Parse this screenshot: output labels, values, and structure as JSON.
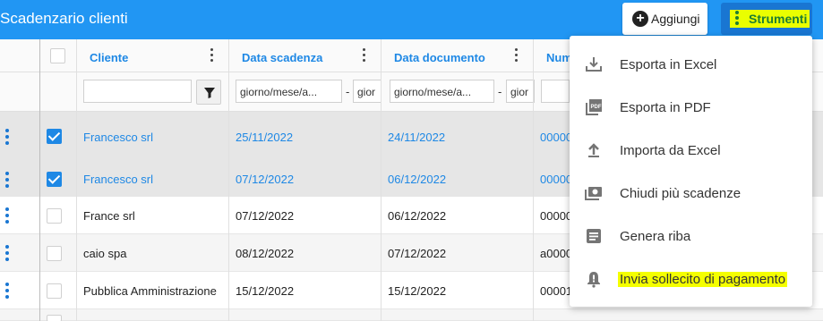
{
  "header": {
    "title": "Scadenzario clienti",
    "add_label": "Aggiungi",
    "tools_label": "Strumenti",
    "tools_highlight_color": "#eaff00"
  },
  "columns": [
    {
      "label": "Cliente"
    },
    {
      "label": "Data scadenza"
    },
    {
      "label": "Data documento"
    },
    {
      "label": "Num"
    }
  ],
  "filters": {
    "cliente_value": "",
    "date_placeholder": "giorno/mese/a...",
    "date_partial": "gior",
    "dash": "-"
  },
  "rows": [
    {
      "checked": true,
      "cliente": "Francesco srl",
      "scadenza": "25/11/2022",
      "documento": "24/11/2022",
      "numero": "00000"
    },
    {
      "checked": true,
      "cliente": "Francesco srl",
      "scadenza": "07/12/2022",
      "documento": "06/12/2022",
      "numero": "00000"
    },
    {
      "checked": false,
      "cliente": "France srl",
      "scadenza": "07/12/2022",
      "documento": "06/12/2022",
      "numero": "00000"
    },
    {
      "checked": false,
      "cliente": "caio spa",
      "scadenza": "08/12/2022",
      "documento": "07/12/2022",
      "numero": "a0000"
    },
    {
      "checked": false,
      "cliente": "Pubblica Amministrazione",
      "scadenza": "15/12/2022",
      "documento": "15/12/2022",
      "numero": "00001"
    }
  ],
  "menu": {
    "items": [
      {
        "label": "Esporta in Excel",
        "icon": "download-icon"
      },
      {
        "label": "Esporta in PDF",
        "icon": "pdf-icon"
      },
      {
        "label": "Importa da Excel",
        "icon": "upload-icon"
      },
      {
        "label": "Chiudi più scadenze",
        "icon": "payments-icon"
      },
      {
        "label": "Genera riba",
        "icon": "document-icon"
      },
      {
        "label": "Invia sollecito di pagamento",
        "icon": "alert-bell-icon",
        "highlighted": true
      }
    ]
  },
  "colors": {
    "header_bg": "#2196f3",
    "accent": "#1e88e5",
    "highlight": "#f4ff00"
  }
}
